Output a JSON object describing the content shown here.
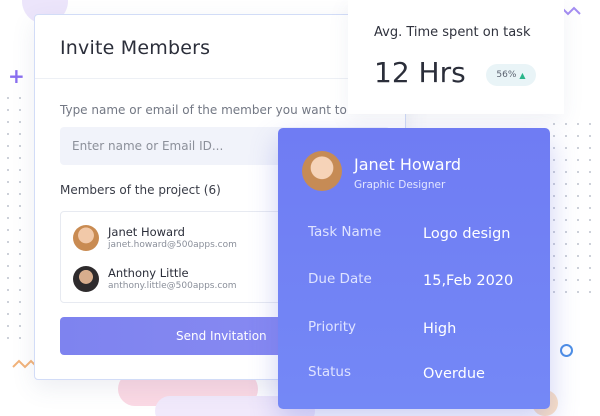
{
  "colors": {
    "accent": "#7e83ef",
    "task_card": "#6f7cf3",
    "badge_up": "#2bb58a"
  },
  "invite": {
    "title": "Invite Members",
    "hint": "Type name or email of the member you want to invite",
    "search_placeholder": "Enter name or Email ID...",
    "members_label": "Members of the project (6)",
    "members": [
      {
        "name": "Janet Howard",
        "email": "janet.howard@500apps.com",
        "avatar": "avatar"
      },
      {
        "name": "Anthony Little",
        "email": "anthony.little@500apps.com",
        "avatar": "avatar"
      }
    ],
    "send_label": "Send Invitation"
  },
  "stat": {
    "title": "Avg. Time spent on task",
    "value": "12 Hrs",
    "badge": "56%",
    "badge_icon": "arrow-up-icon"
  },
  "task": {
    "name": "Janet Howard",
    "role": "Graphic Designer",
    "fields": [
      {
        "label": "Task Name",
        "value": "Logo design"
      },
      {
        "label": "Due Date",
        "value": "15,Feb 2020"
      },
      {
        "label": "Priority",
        "value": "High"
      },
      {
        "label": "Status",
        "value": "Overdue"
      }
    ]
  }
}
